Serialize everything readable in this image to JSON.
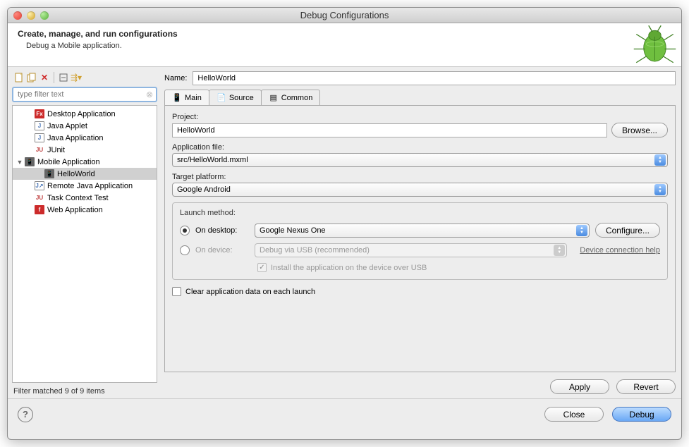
{
  "window": {
    "title": "Debug Configurations"
  },
  "banner": {
    "heading": "Create, manage, and run configurations",
    "sub": "Debug a Mobile application."
  },
  "filter": {
    "placeholder": "type filter text",
    "status": "Filter matched 9 of 9 items"
  },
  "tree": [
    {
      "label": "Desktop Application",
      "indent": 1,
      "iconBg": "#cc2b2b",
      "iconTxt": "Fx"
    },
    {
      "label": "Java Applet",
      "indent": 1,
      "iconBg": "#ffffff",
      "iconTxt": "J",
      "iconColor": "#4a76b8",
      "border": true
    },
    {
      "label": "Java Application",
      "indent": 1,
      "iconBg": "#ffffff",
      "iconTxt": "J",
      "iconColor": "#4a76b8",
      "border": true
    },
    {
      "label": "JUnit",
      "indent": 1,
      "iconBg": "#ffffff",
      "iconTxt": "JU",
      "iconColor": "#c04040",
      "border": false
    },
    {
      "label": "Mobile Application",
      "indent": 0,
      "expanded": true,
      "iconBg": "#666666",
      "iconTxt": "📱",
      "iconColor": "#fff"
    },
    {
      "label": "HelloWorld",
      "indent": 2,
      "selected": true,
      "iconBg": "#666666",
      "iconTxt": "📱",
      "iconColor": "#fff"
    },
    {
      "label": "Remote Java Application",
      "indent": 1,
      "iconBg": "#ffffff",
      "iconTxt": "J↗",
      "iconColor": "#4a76b8",
      "border": true
    },
    {
      "label": "Task Context Test",
      "indent": 1,
      "iconBg": "#ffffff",
      "iconTxt": "JU",
      "iconColor": "#c04040"
    },
    {
      "label": "Web Application",
      "indent": 1,
      "iconBg": "#cc2b2b",
      "iconTxt": "f"
    }
  ],
  "name": {
    "label": "Name:",
    "value": "HelloWorld"
  },
  "tabs": [
    {
      "label": "Main",
      "active": true
    },
    {
      "label": "Source",
      "active": false
    },
    {
      "label": "Common",
      "active": false
    }
  ],
  "project": {
    "label": "Project:",
    "value": "HelloWorld",
    "browse": "Browse..."
  },
  "appfile": {
    "label": "Application file:",
    "value": "src/HelloWorld.mxml"
  },
  "target": {
    "label": "Target platform:",
    "value": "Google Android"
  },
  "launch": {
    "title": "Launch method:",
    "desktop": {
      "label": "On desktop:",
      "value": "Google Nexus One",
      "configure": "Configure..."
    },
    "device": {
      "label": "On device:",
      "value": "Debug via USB (recommended)",
      "help": "Device connection help"
    },
    "install": "Install the application on the device over USB"
  },
  "clear": "Clear application data on each launch",
  "buttons": {
    "apply": "Apply",
    "revert": "Revert",
    "close": "Close",
    "debug": "Debug"
  }
}
